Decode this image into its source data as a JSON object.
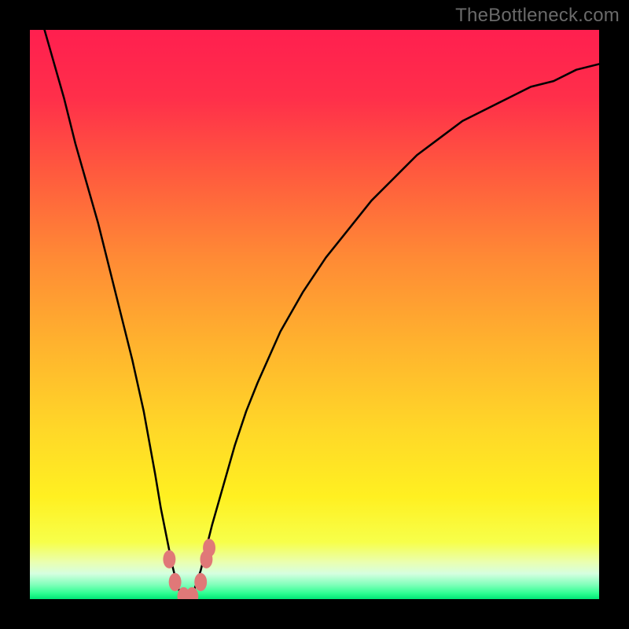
{
  "watermark": "TheBottleneck.com",
  "chart_data": {
    "type": "line",
    "title": "",
    "xlabel": "",
    "ylabel": "",
    "xlim": [
      0,
      100
    ],
    "ylim": [
      0,
      100
    ],
    "x": [
      0,
      2,
      4,
      6,
      8,
      10,
      12,
      14,
      16,
      18,
      20,
      22,
      23,
      24,
      25,
      26,
      27,
      28,
      29,
      30,
      31,
      32,
      34,
      36,
      38,
      40,
      44,
      48,
      52,
      56,
      60,
      64,
      68,
      72,
      76,
      80,
      84,
      88,
      92,
      96,
      100
    ],
    "values": [
      110,
      102,
      95,
      88,
      80,
      73,
      66,
      58,
      50,
      42,
      33,
      22,
      16,
      11,
      6,
      2,
      0,
      0,
      2,
      5,
      9,
      13,
      20,
      27,
      33,
      38,
      47,
      54,
      60,
      65,
      70,
      74,
      78,
      81,
      84,
      86,
      88,
      90,
      91,
      93,
      94
    ],
    "minimum_x": 27.5,
    "gradient_stops": [
      {
        "offset": 0.0,
        "color": "#ff1f4f"
      },
      {
        "offset": 0.12,
        "color": "#ff2f4a"
      },
      {
        "offset": 0.25,
        "color": "#ff5a3e"
      },
      {
        "offset": 0.4,
        "color": "#ff8a35"
      },
      {
        "offset": 0.55,
        "color": "#ffb22e"
      },
      {
        "offset": 0.7,
        "color": "#ffd728"
      },
      {
        "offset": 0.82,
        "color": "#fff021"
      },
      {
        "offset": 0.9,
        "color": "#f7ff4a"
      },
      {
        "offset": 0.935,
        "color": "#eaffb0"
      },
      {
        "offset": 0.955,
        "color": "#d6ffe0"
      },
      {
        "offset": 0.975,
        "color": "#7fffba"
      },
      {
        "offset": 0.99,
        "color": "#2dff91"
      },
      {
        "offset": 1.0,
        "color": "#00e676"
      }
    ],
    "markers": [
      {
        "x": 24.5,
        "y": 7
      },
      {
        "x": 25.5,
        "y": 3
      },
      {
        "x": 27.0,
        "y": 0.5
      },
      {
        "x": 28.5,
        "y": 0.5
      },
      {
        "x": 30.0,
        "y": 3
      },
      {
        "x": 31.0,
        "y": 7
      },
      {
        "x": 31.5,
        "y": 9
      }
    ],
    "marker_color": "#e07878",
    "curve_color": "#000000"
  }
}
